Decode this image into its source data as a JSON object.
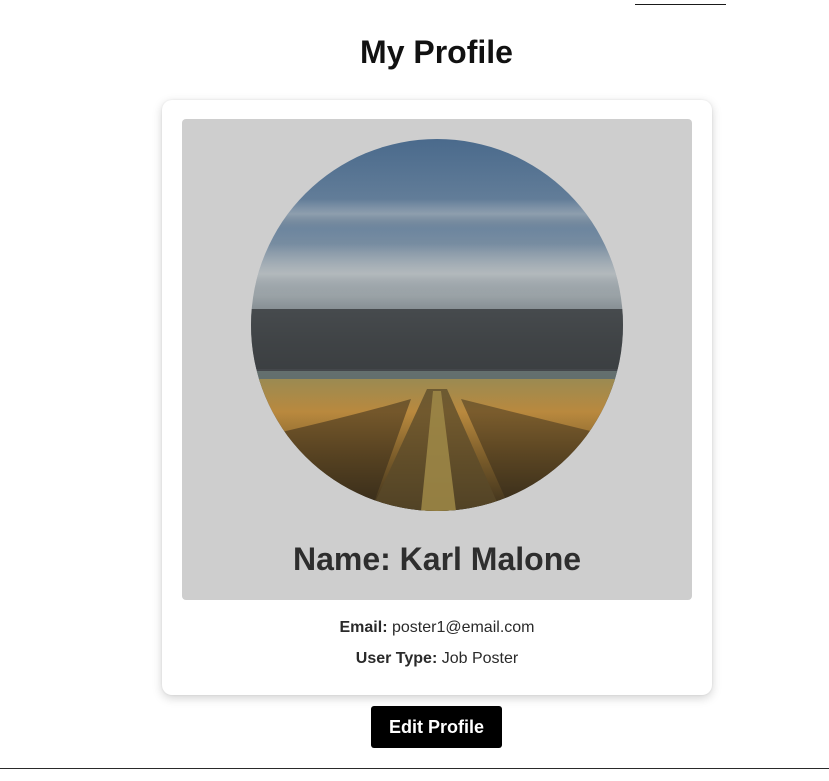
{
  "page": {
    "title": "My Profile"
  },
  "profile": {
    "name_text": "Name: Karl Malone",
    "avatar": "landscape-field-photo",
    "email_label": "Email:",
    "email_value": "poster1@email.com",
    "user_type_label": "User Type:",
    "user_type_value": "Job Poster"
  },
  "actions": {
    "edit_label": "Edit Profile"
  },
  "colors": {
    "card_panel": "#cecece",
    "button_bg": "#000000",
    "button_text": "#ffffff"
  }
}
